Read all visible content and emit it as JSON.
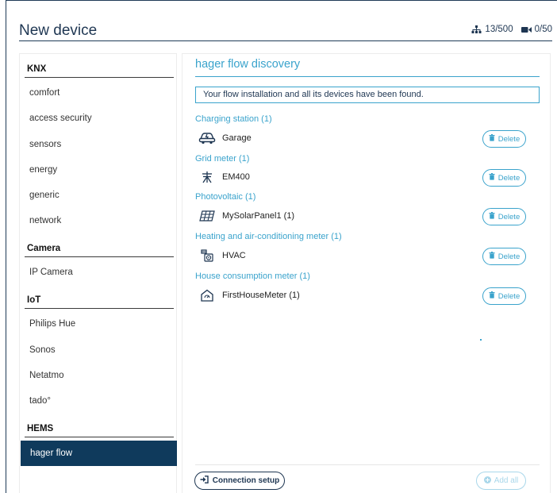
{
  "header": {
    "title": "New device",
    "nodes_count": "13/500",
    "cameras_count": "0/50",
    "nodes_icon": "network-tree-icon",
    "cameras_icon": "video-camera-icon"
  },
  "sidebar": {
    "categories": [
      {
        "label": "KNX",
        "items": [
          "comfort",
          "access security",
          "sensors",
          "energy",
          "generic",
          "network"
        ]
      },
      {
        "label": "Camera",
        "items": [
          "IP Camera"
        ]
      },
      {
        "label": "IoT",
        "items": [
          "Philips Hue",
          "Sonos",
          "Netatmo",
          "tado°"
        ]
      },
      {
        "label": "HEMS",
        "items": [
          "hager flow"
        ]
      }
    ],
    "active_item": "hager flow"
  },
  "main": {
    "title": "hager flow discovery",
    "notice": "Your flow installation and all its devices have been found.",
    "groups": [
      {
        "label": "Charging station (1)",
        "device": "Garage",
        "icon": "car-charging-icon",
        "action": "Delete"
      },
      {
        "label": "Grid meter (1)",
        "device": "EM400",
        "icon": "power-pylon-icon",
        "action": "Delete"
      },
      {
        "label": "Photovoltaic (1)",
        "device": "MySolarPanel1 (1)",
        "icon": "solar-panel-icon",
        "action": "Delete"
      },
      {
        "label": "Heating and air-conditioning meter (1)",
        "device": "HVAC",
        "icon": "hvac-meter-icon",
        "action": "Delete"
      },
      {
        "label": "House consumption meter (1)",
        "device": "FirstHouseMeter (1)",
        "icon": "house-meter-icon",
        "action": "Delete"
      }
    ],
    "connection_setup": "Connection setup",
    "add_all": "Add all"
  },
  "colors": {
    "navy": "#0f3a5c",
    "accent": "#3aa3cc",
    "disabled": "#a9d7ea"
  }
}
